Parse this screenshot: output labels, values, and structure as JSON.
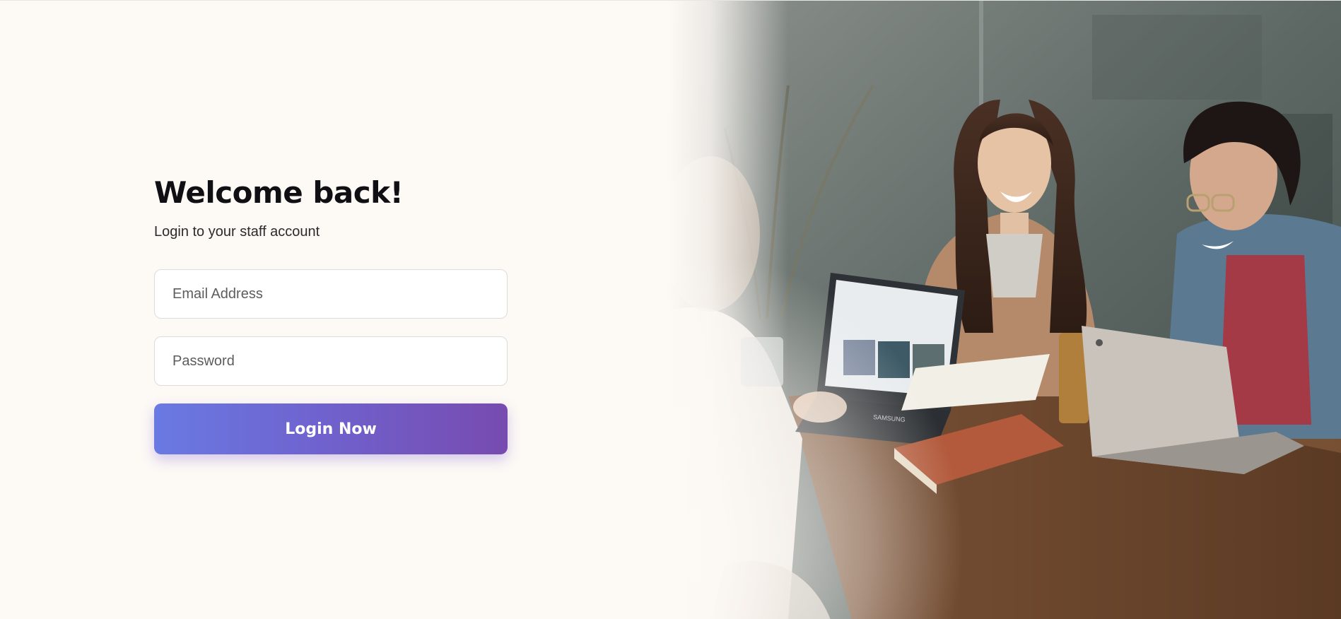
{
  "login": {
    "title": "Welcome back!",
    "subtitle": "Login to your staff account",
    "email_placeholder": "Email Address",
    "password_placeholder": "Password",
    "submit_label": "Login Now"
  },
  "colors": {
    "background": "#fdf9f5",
    "button_gradient_start": "#6a7ae2",
    "button_gradient_end": "#774bb0",
    "title": "#0f0f14"
  },
  "hero_image": {
    "icon": "people-working-laptops-photo",
    "laptop_brand_label": "SAMSUNG"
  }
}
